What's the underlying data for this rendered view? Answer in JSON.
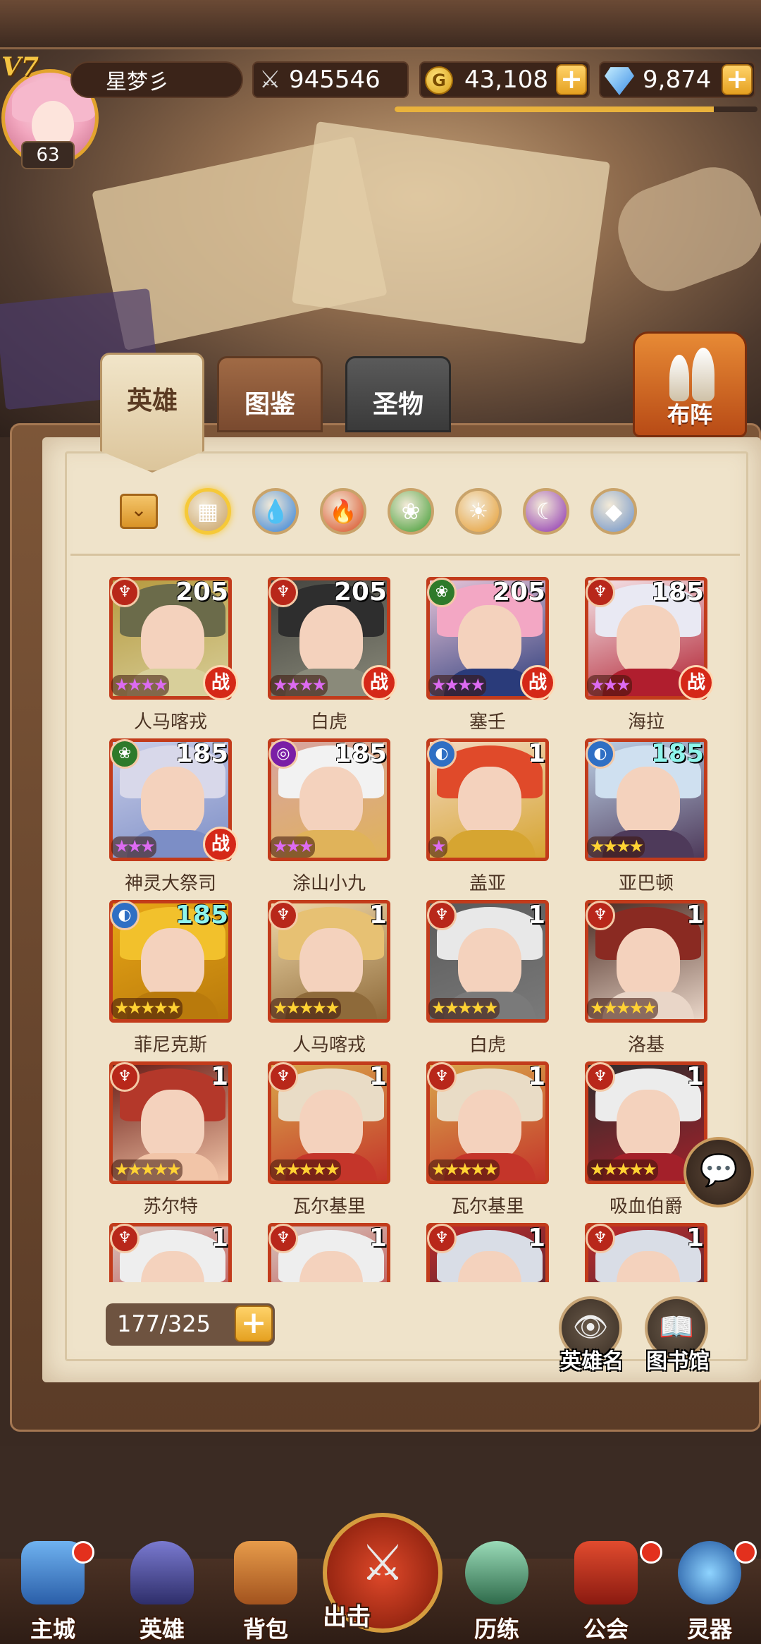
{
  "player": {
    "vip": "V7",
    "level": "63",
    "name": "星梦彡",
    "xp_fraction": 0.88
  },
  "resources": {
    "power": "945546",
    "gold": "43,108",
    "gems": "9,874",
    "gold_icon": "G",
    "plus": "+"
  },
  "tabs": {
    "heroes": "英雄",
    "codex": "图鉴",
    "relics": "圣物"
  },
  "formation": {
    "label": "布阵"
  },
  "filters": [
    "all",
    "water",
    "fire",
    "nature",
    "light",
    "dark",
    "mech"
  ],
  "filter_colors": {
    "all": "#c8a062",
    "water": "#2f7fd8",
    "fire": "#d84a1f",
    "nature": "#3c9a2f",
    "light": "#e59b2e",
    "dark": "#8a2fb0",
    "mech": "#6a90c8"
  },
  "battle_badge": "战",
  "heroes": [
    {
      "name": "人马喀戎",
      "level": "205",
      "stars": "★★★★",
      "star_color": "purple",
      "battle": true,
      "faction": "fire",
      "colors": [
        "#6b6b4a",
        "#d8cf9a",
        "#b69a3f"
      ]
    },
    {
      "name": "白虎",
      "level": "205",
      "stars": "★★★★",
      "star_color": "purple",
      "battle": true,
      "faction": "fire",
      "colors": [
        "#2e2e2e",
        "#8a8a7a",
        "#454540"
      ]
    },
    {
      "name": "塞壬",
      "level": "205",
      "stars": "★★★★",
      "star_color": "purple",
      "battle": true,
      "faction": "nature",
      "colors": [
        "#f3a7c4",
        "#2a3b7a",
        "#e7c4d8"
      ]
    },
    {
      "name": "海拉",
      "level": "185",
      "stars": "★★★",
      "star_color": "purple",
      "battle": true,
      "faction": "fire",
      "colors": [
        "#e9e9f3",
        "#b01e2e",
        "#f5e6ea"
      ]
    },
    {
      "name": "神灵大祭司",
      "level": "185",
      "stars": "★★★",
      "star_color": "purple",
      "battle": true,
      "faction": "nature",
      "colors": [
        "#d8d8ea",
        "#7c8ec6",
        "#c9cde8"
      ]
    },
    {
      "name": "涂山小九",
      "level": "185",
      "stars": "★★★",
      "star_color": "purple",
      "battle": false,
      "faction": "dark",
      "colors": [
        "#f2f2f2",
        "#e0b35a",
        "#d8a3a0"
      ]
    },
    {
      "name": "盖亚",
      "level": "1",
      "stars": "★",
      "star_color": "purple",
      "battle": false,
      "faction": "mech",
      "colors": [
        "#e04a2a",
        "#d6a531",
        "#f3d8c0"
      ]
    },
    {
      "name": "亚巴顿",
      "level": "185",
      "level_color": "cyan",
      "stars": "★★★★",
      "star_color": "gold",
      "battle": false,
      "faction": "mech",
      "colors": [
        "#cfe0f0",
        "#4e3a5a",
        "#bcd0e6"
      ]
    },
    {
      "name": "菲尼克斯",
      "level": "185",
      "level_color": "cyan",
      "stars": "★★★★★",
      "star_color": "gold",
      "battle": false,
      "faction": "mech",
      "colors": [
        "#f2c12c",
        "#b97a0c",
        "#e8a616"
      ]
    },
    {
      "name": "人马喀戎",
      "level": "1",
      "stars": "★★★★★",
      "star_color": "gold",
      "battle": false,
      "faction": "fire",
      "colors": [
        "#e7c173",
        "#8e6a3a",
        "#f0d8a8"
      ]
    },
    {
      "name": "白虎",
      "level": "1",
      "stars": "★★★★★",
      "star_color": "gold",
      "battle": false,
      "faction": "fire",
      "colors": [
        "#e8e8e8",
        "#7a7a7a",
        "#5a5a5a"
      ]
    },
    {
      "name": "洛基",
      "level": "1",
      "stars": "★★★★★",
      "star_color": "gold",
      "battle": false,
      "faction": "fire",
      "colors": [
        "#8a2a22",
        "#e9d6c8",
        "#4a2a22"
      ]
    },
    {
      "name": "苏尔特",
      "level": "1",
      "stars": "★★★★★",
      "star_color": "gold",
      "battle": false,
      "faction": "fire",
      "colors": [
        "#b4382a",
        "#f2c5a8",
        "#6a1c16"
      ]
    },
    {
      "name": "瓦尔基里",
      "level": "1",
      "stars": "★★★★★",
      "star_color": "gold",
      "battle": false,
      "faction": "fire",
      "colors": [
        "#e9dcc6",
        "#c4352a",
        "#d9a64a"
      ]
    },
    {
      "name": "瓦尔基里",
      "level": "1",
      "stars": "★★★★★",
      "star_color": "gold",
      "battle": false,
      "faction": "fire",
      "colors": [
        "#e9dcc6",
        "#c4352a",
        "#d9a64a"
      ]
    },
    {
      "name": "吸血伯爵",
      "level": "1",
      "stars": "★★★★★",
      "star_color": "gold",
      "battle": false,
      "faction": "fire",
      "colors": [
        "#ececec",
        "#a3202a",
        "#2e2e2e"
      ]
    },
    {
      "name": "",
      "level": "1",
      "stars": "",
      "star_color": "gold",
      "battle": false,
      "faction": "fire",
      "colors": [
        "#eeeeee",
        "#b92a2a",
        "#d8c8c0"
      ]
    },
    {
      "name": "",
      "level": "1",
      "stars": "",
      "star_color": "gold",
      "battle": false,
      "faction": "fire",
      "colors": [
        "#eeeeee",
        "#b92a2a",
        "#d8c8c0"
      ]
    },
    {
      "name": "",
      "level": "1",
      "stars": "",
      "star_color": "gold",
      "battle": false,
      "faction": "fire",
      "colors": [
        "#d9dde6",
        "#2a2a3a",
        "#c02a2a"
      ]
    },
    {
      "name": "",
      "level": "1",
      "stars": "",
      "star_color": "gold",
      "battle": false,
      "faction": "fire",
      "colors": [
        "#d9dde6",
        "#2a2a3a",
        "#c02a2a"
      ]
    }
  ],
  "collection": {
    "count": "177/325"
  },
  "buttons": {
    "hero_names": "英雄名",
    "library": "图书馆"
  },
  "nav": {
    "main_city": "主城",
    "heroes": "英雄",
    "backpack": "背包",
    "sortie": "出击",
    "training": "历练",
    "guild": "公会",
    "artifact": "灵器"
  }
}
